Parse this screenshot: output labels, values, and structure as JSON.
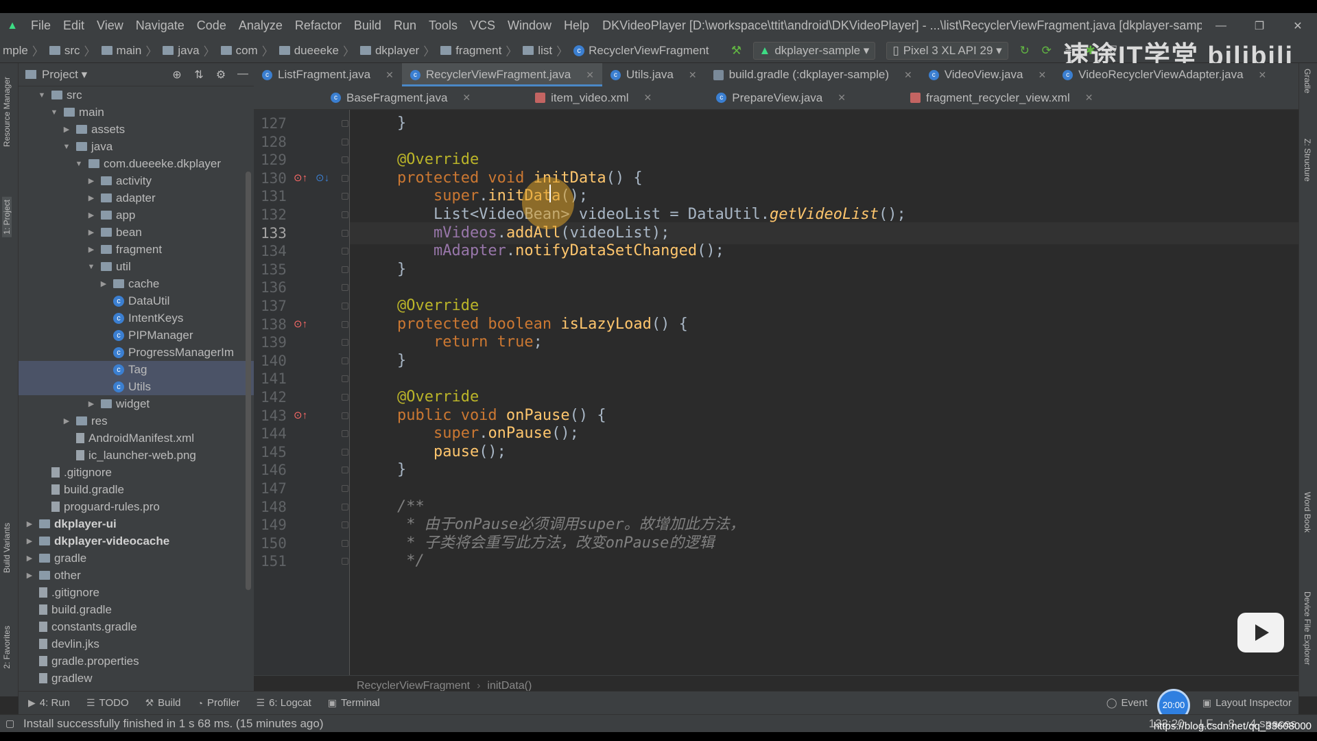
{
  "menubar": {
    "items": [
      "File",
      "Edit",
      "View",
      "Navigate",
      "Code",
      "Analyze",
      "Refactor",
      "Build",
      "Run",
      "Tools",
      "VCS",
      "Window",
      "Help"
    ],
    "window_title": "DKVideoPlayer [D:\\workspace\\ttit\\android\\DKVideoPlayer] - ...\\list\\RecyclerViewFragment.java [dkplayer-sample]",
    "controls": [
      "—",
      "❐",
      "✕"
    ]
  },
  "navbar": {
    "crumbs": [
      "mple",
      "src",
      "main",
      "java",
      "com",
      "dueeeke",
      "dkplayer",
      "fragment",
      "list",
      "RecyclerViewFragment"
    ],
    "run_config": "dkplayer-sample",
    "device": "Pixel 3 XL API 29"
  },
  "watermark": "速途IT学堂 bilibili",
  "project": {
    "title": "Project",
    "tree": [
      {
        "label": "src",
        "depth": 1,
        "arrow": "▼",
        "icon": "folder"
      },
      {
        "label": "main",
        "depth": 2,
        "arrow": "▼",
        "icon": "folder"
      },
      {
        "label": "assets",
        "depth": 3,
        "arrow": "▶",
        "icon": "folder"
      },
      {
        "label": "java",
        "depth": 3,
        "arrow": "▼",
        "icon": "folder"
      },
      {
        "label": "com.dueeeke.dkplayer",
        "depth": 4,
        "arrow": "▼",
        "icon": "folder"
      },
      {
        "label": "activity",
        "depth": 5,
        "arrow": "▶",
        "icon": "folder"
      },
      {
        "label": "adapter",
        "depth": 5,
        "arrow": "▶",
        "icon": "folder"
      },
      {
        "label": "app",
        "depth": 5,
        "arrow": "▶",
        "icon": "folder"
      },
      {
        "label": "bean",
        "depth": 5,
        "arrow": "▶",
        "icon": "folder"
      },
      {
        "label": "fragment",
        "depth": 5,
        "arrow": "▶",
        "icon": "folder"
      },
      {
        "label": "util",
        "depth": 5,
        "arrow": "▼",
        "icon": "folder"
      },
      {
        "label": "cache",
        "depth": 6,
        "arrow": "▶",
        "icon": "folder"
      },
      {
        "label": "DataUtil",
        "depth": 6,
        "arrow": "",
        "icon": "class"
      },
      {
        "label": "IntentKeys",
        "depth": 6,
        "arrow": "",
        "icon": "class"
      },
      {
        "label": "PIPManager",
        "depth": 6,
        "arrow": "",
        "icon": "class"
      },
      {
        "label": "ProgressManagerIm",
        "depth": 6,
        "arrow": "",
        "icon": "class"
      },
      {
        "label": "Tag",
        "depth": 6,
        "arrow": "",
        "icon": "class",
        "selected": true
      },
      {
        "label": "Utils",
        "depth": 6,
        "arrow": "",
        "icon": "class",
        "selected": true
      },
      {
        "label": "widget",
        "depth": 5,
        "arrow": "▶",
        "icon": "folder"
      },
      {
        "label": "res",
        "depth": 3,
        "arrow": "▶",
        "icon": "folder"
      },
      {
        "label": "AndroidManifest.xml",
        "depth": 3,
        "arrow": "",
        "icon": "file"
      },
      {
        "label": "ic_launcher-web.png",
        "depth": 3,
        "arrow": "",
        "icon": "file"
      },
      {
        "label": ".gitignore",
        "depth": 1,
        "arrow": "",
        "icon": "file"
      },
      {
        "label": "build.gradle",
        "depth": 1,
        "arrow": "",
        "icon": "file"
      },
      {
        "label": "proguard-rules.pro",
        "depth": 1,
        "arrow": "",
        "icon": "file"
      },
      {
        "label": "dkplayer-ui",
        "depth": 0,
        "arrow": "▶",
        "icon": "folder",
        "bold": true
      },
      {
        "label": "dkplayer-videocache",
        "depth": 0,
        "arrow": "▶",
        "icon": "folder",
        "bold": true
      },
      {
        "label": "gradle",
        "depth": 0,
        "arrow": "▶",
        "icon": "folder"
      },
      {
        "label": "other",
        "depth": 0,
        "arrow": "▶",
        "icon": "folder"
      },
      {
        "label": ".gitignore",
        "depth": 0,
        "arrow": "",
        "icon": "file"
      },
      {
        "label": "build.gradle",
        "depth": 0,
        "arrow": "",
        "icon": "file"
      },
      {
        "label": "constants.gradle",
        "depth": 0,
        "arrow": "",
        "icon": "file"
      },
      {
        "label": "devlin.jks",
        "depth": 0,
        "arrow": "",
        "icon": "file"
      },
      {
        "label": "gradle.properties",
        "depth": 0,
        "arrow": "",
        "icon": "file"
      },
      {
        "label": "gradlew",
        "depth": 0,
        "arrow": "",
        "icon": "file"
      }
    ]
  },
  "left_strip": [
    "Resource Manager",
    "1: Project",
    "Build Variants",
    "2: Favorites"
  ],
  "right_strip": [
    "Gradle",
    "Z: Structure",
    "Word Book",
    "Device File Explorer"
  ],
  "tabs_row1": [
    {
      "label": "ListFragment.java",
      "icon": "class"
    },
    {
      "label": "RecyclerViewFragment.java",
      "icon": "class",
      "active": true
    },
    {
      "label": "Utils.java",
      "icon": "class"
    },
    {
      "label": "build.gradle (:dkplayer-sample)",
      "icon": "gradle"
    },
    {
      "label": "VideoView.java",
      "icon": "class"
    },
    {
      "label": "VideoRecyclerViewAdapter.java",
      "icon": "class"
    }
  ],
  "tabs_row2": [
    {
      "label": "BaseFragment.java",
      "icon": "class"
    },
    {
      "label": "item_video.xml",
      "icon": "xml"
    },
    {
      "label": "PrepareView.java",
      "icon": "class"
    },
    {
      "label": "fragment_recycler_view.xml",
      "icon": "xml"
    }
  ],
  "code": {
    "current_line": 133,
    "lines": [
      {
        "n": 127,
        "tokens": [
          [
            "txt",
            "    }"
          ]
        ]
      },
      {
        "n": 128,
        "tokens": []
      },
      {
        "n": 129,
        "tokens": [
          [
            "an",
            "    @Override"
          ]
        ]
      },
      {
        "n": 130,
        "mark": "override-up",
        "tokens": [
          [
            "kw",
            "    protected void "
          ],
          [
            "fn",
            "initData"
          ],
          [
            "txt",
            "() {"
          ]
        ]
      },
      {
        "n": 131,
        "tokens": [
          [
            "kw",
            "        super"
          ],
          [
            "txt",
            "."
          ],
          [
            "fn",
            "initData"
          ],
          [
            "txt",
            "();"
          ]
        ]
      },
      {
        "n": 132,
        "tokens": [
          [
            "ty",
            "        List<VideoBean> videoList = DataUtil."
          ],
          [
            "mc",
            "getVideoList"
          ],
          [
            "txt",
            "();"
          ]
        ]
      },
      {
        "n": 133,
        "tokens": [
          [
            "fld",
            "        mVideos"
          ],
          [
            "txt",
            "."
          ],
          [
            "fn",
            "addAll"
          ],
          [
            "txt",
            "(videoList);"
          ]
        ]
      },
      {
        "n": 134,
        "tokens": [
          [
            "fld",
            "        mAdapter"
          ],
          [
            "txt",
            "."
          ],
          [
            "fn",
            "notifyDataSetChanged"
          ],
          [
            "txt",
            "();"
          ]
        ]
      },
      {
        "n": 135,
        "tokens": [
          [
            "txt",
            "    }"
          ]
        ]
      },
      {
        "n": 136,
        "tokens": []
      },
      {
        "n": 137,
        "tokens": [
          [
            "an",
            "    @Override"
          ]
        ]
      },
      {
        "n": 138,
        "mark": "override",
        "tokens": [
          [
            "kw",
            "    protected boolean "
          ],
          [
            "fn",
            "isLazyLoad"
          ],
          [
            "txt",
            "() {"
          ]
        ]
      },
      {
        "n": 139,
        "tokens": [
          [
            "kw",
            "        return true"
          ],
          [
            "txt",
            ";"
          ]
        ]
      },
      {
        "n": 140,
        "tokens": [
          [
            "txt",
            "    }"
          ]
        ]
      },
      {
        "n": 141,
        "tokens": []
      },
      {
        "n": 142,
        "tokens": [
          [
            "an",
            "    @Override"
          ]
        ]
      },
      {
        "n": 143,
        "mark": "override",
        "tokens": [
          [
            "kw",
            "    public void "
          ],
          [
            "fn",
            "onPause"
          ],
          [
            "txt",
            "() {"
          ]
        ]
      },
      {
        "n": 144,
        "tokens": [
          [
            "kw",
            "        super"
          ],
          [
            "txt",
            "."
          ],
          [
            "fn",
            "onPause"
          ],
          [
            "txt",
            "();"
          ]
        ]
      },
      {
        "n": 145,
        "tokens": [
          [
            "fn",
            "        pause"
          ],
          [
            "txt",
            "();"
          ]
        ]
      },
      {
        "n": 146,
        "tokens": [
          [
            "txt",
            "    }"
          ]
        ]
      },
      {
        "n": 147,
        "tokens": []
      },
      {
        "n": 148,
        "tokens": [
          [
            "cm",
            "    /**"
          ]
        ]
      },
      {
        "n": 149,
        "tokens": [
          [
            "cm",
            "     * 由于onPause必须调用super。故增加此方法，"
          ]
        ]
      },
      {
        "n": 150,
        "tokens": [
          [
            "cm",
            "     * 子类将会重写此方法，改变onPause的逻辑"
          ]
        ]
      },
      {
        "n": 151,
        "tokens": [
          [
            "cm",
            "     */"
          ]
        ]
      }
    ]
  },
  "editor_breadcrumb": [
    "RecyclerViewFragment",
    "initData()"
  ],
  "bottom_tools": [
    "4: Run",
    "TODO",
    "Build",
    "Profiler",
    "6: Logcat",
    "Terminal"
  ],
  "bottom_right": [
    "Event",
    "Layout Inspector"
  ],
  "clock": "20:00",
  "status": {
    "message": "Install successfully finished in 1 s 68 ms. (15 minutes ago)",
    "position": "133:20",
    "line_sep": "LF",
    "encoding": "8",
    "indent": "4 spaces"
  },
  "source_url": "https://blog.csdn.net/qq_33608000"
}
